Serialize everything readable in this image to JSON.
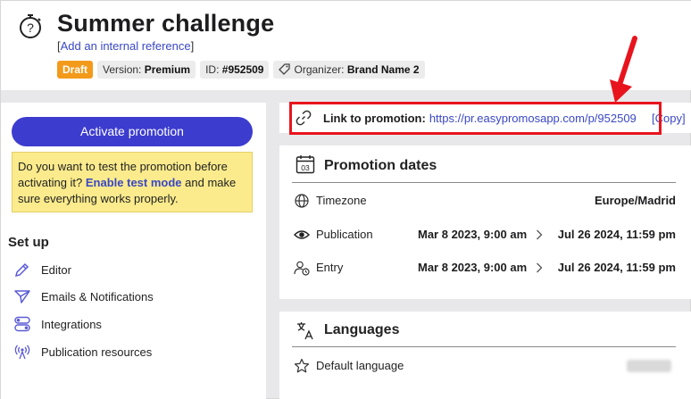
{
  "header": {
    "title": "Summer challenge",
    "ref_open": "[",
    "ref_link": "Add an internal reference",
    "ref_close": "]",
    "badges": {
      "status": "Draft",
      "version_label": "Version:",
      "version_value": "Premium",
      "id_label": "ID:",
      "id_value": "#952509",
      "organizer_label": "Organizer:",
      "organizer_value": "Brand Name 2"
    }
  },
  "left": {
    "activate_label": "Activate promotion",
    "test_text_1": "Do you want to test the promotion before activating it?",
    "test_link": "Enable test mode",
    "test_text_2": "and make sure everything works properly.",
    "setup_title": "Set up",
    "setup_items": [
      {
        "label": "Editor",
        "icon": "pencil-icon"
      },
      {
        "label": "Emails & Notifications",
        "icon": "paper-plane-icon"
      },
      {
        "label": "Integrations",
        "icon": "toggles-icon"
      },
      {
        "label": "Publication resources",
        "icon": "broadcast-icon"
      }
    ]
  },
  "link": {
    "label": "Link to promotion:",
    "url": "https://pr.easypromosapp.com/p/952509",
    "copy": "[Copy]"
  },
  "dates": {
    "title": "Promotion dates",
    "calendar_day": "03",
    "timezone_label": "Timezone",
    "timezone_value": "Europe/Madrid",
    "publication_label": "Publication",
    "publication_from": "Mar 8 2023, 9:00 am",
    "publication_to": "Jul 26 2024, 11:59 pm",
    "entry_label": "Entry",
    "entry_from": "Mar 8 2023, 9:00 am",
    "entry_to": "Jul 26 2024, 11:59 pm"
  },
  "languages": {
    "title": "Languages",
    "default_label": "Default language"
  },
  "colors": {
    "accent": "#3c3ccf",
    "draft": "#f39a1b",
    "highlight": "#e8141d",
    "warning_bg": "#fbeb8c"
  }
}
